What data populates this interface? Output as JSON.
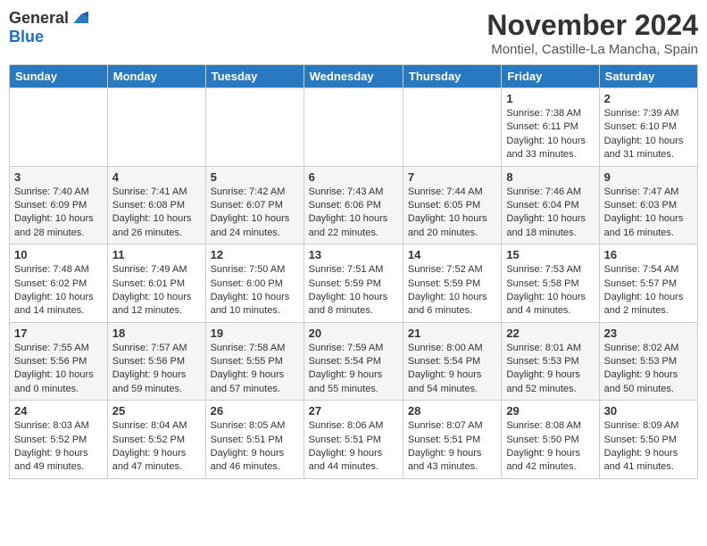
{
  "logo": {
    "general": "General",
    "blue": "Blue"
  },
  "title": "November 2024",
  "location": "Montiel, Castille-La Mancha, Spain",
  "days_of_week": [
    "Sunday",
    "Monday",
    "Tuesday",
    "Wednesday",
    "Thursday",
    "Friday",
    "Saturday"
  ],
  "weeks": [
    [
      {
        "day": "",
        "info": ""
      },
      {
        "day": "",
        "info": ""
      },
      {
        "day": "",
        "info": ""
      },
      {
        "day": "",
        "info": ""
      },
      {
        "day": "",
        "info": ""
      },
      {
        "day": "1",
        "info": "Sunrise: 7:38 AM\nSunset: 6:11 PM\nDaylight: 10 hours and 33 minutes."
      },
      {
        "day": "2",
        "info": "Sunrise: 7:39 AM\nSunset: 6:10 PM\nDaylight: 10 hours and 31 minutes."
      }
    ],
    [
      {
        "day": "3",
        "info": "Sunrise: 7:40 AM\nSunset: 6:09 PM\nDaylight: 10 hours and 28 minutes."
      },
      {
        "day": "4",
        "info": "Sunrise: 7:41 AM\nSunset: 6:08 PM\nDaylight: 10 hours and 26 minutes."
      },
      {
        "day": "5",
        "info": "Sunrise: 7:42 AM\nSunset: 6:07 PM\nDaylight: 10 hours and 24 minutes."
      },
      {
        "day": "6",
        "info": "Sunrise: 7:43 AM\nSunset: 6:06 PM\nDaylight: 10 hours and 22 minutes."
      },
      {
        "day": "7",
        "info": "Sunrise: 7:44 AM\nSunset: 6:05 PM\nDaylight: 10 hours and 20 minutes."
      },
      {
        "day": "8",
        "info": "Sunrise: 7:46 AM\nSunset: 6:04 PM\nDaylight: 10 hours and 18 minutes."
      },
      {
        "day": "9",
        "info": "Sunrise: 7:47 AM\nSunset: 6:03 PM\nDaylight: 10 hours and 16 minutes."
      }
    ],
    [
      {
        "day": "10",
        "info": "Sunrise: 7:48 AM\nSunset: 6:02 PM\nDaylight: 10 hours and 14 minutes."
      },
      {
        "day": "11",
        "info": "Sunrise: 7:49 AM\nSunset: 6:01 PM\nDaylight: 10 hours and 12 minutes."
      },
      {
        "day": "12",
        "info": "Sunrise: 7:50 AM\nSunset: 6:00 PM\nDaylight: 10 hours and 10 minutes."
      },
      {
        "day": "13",
        "info": "Sunrise: 7:51 AM\nSunset: 5:59 PM\nDaylight: 10 hours and 8 minutes."
      },
      {
        "day": "14",
        "info": "Sunrise: 7:52 AM\nSunset: 5:59 PM\nDaylight: 10 hours and 6 minutes."
      },
      {
        "day": "15",
        "info": "Sunrise: 7:53 AM\nSunset: 5:58 PM\nDaylight: 10 hours and 4 minutes."
      },
      {
        "day": "16",
        "info": "Sunrise: 7:54 AM\nSunset: 5:57 PM\nDaylight: 10 hours and 2 minutes."
      }
    ],
    [
      {
        "day": "17",
        "info": "Sunrise: 7:55 AM\nSunset: 5:56 PM\nDaylight: 10 hours and 0 minutes."
      },
      {
        "day": "18",
        "info": "Sunrise: 7:57 AM\nSunset: 5:56 PM\nDaylight: 9 hours and 59 minutes."
      },
      {
        "day": "19",
        "info": "Sunrise: 7:58 AM\nSunset: 5:55 PM\nDaylight: 9 hours and 57 minutes."
      },
      {
        "day": "20",
        "info": "Sunrise: 7:59 AM\nSunset: 5:54 PM\nDaylight: 9 hours and 55 minutes."
      },
      {
        "day": "21",
        "info": "Sunrise: 8:00 AM\nSunset: 5:54 PM\nDaylight: 9 hours and 54 minutes."
      },
      {
        "day": "22",
        "info": "Sunrise: 8:01 AM\nSunset: 5:53 PM\nDaylight: 9 hours and 52 minutes."
      },
      {
        "day": "23",
        "info": "Sunrise: 8:02 AM\nSunset: 5:53 PM\nDaylight: 9 hours and 50 minutes."
      }
    ],
    [
      {
        "day": "24",
        "info": "Sunrise: 8:03 AM\nSunset: 5:52 PM\nDaylight: 9 hours and 49 minutes."
      },
      {
        "day": "25",
        "info": "Sunrise: 8:04 AM\nSunset: 5:52 PM\nDaylight: 9 hours and 47 minutes."
      },
      {
        "day": "26",
        "info": "Sunrise: 8:05 AM\nSunset: 5:51 PM\nDaylight: 9 hours and 46 minutes."
      },
      {
        "day": "27",
        "info": "Sunrise: 8:06 AM\nSunset: 5:51 PM\nDaylight: 9 hours and 44 minutes."
      },
      {
        "day": "28",
        "info": "Sunrise: 8:07 AM\nSunset: 5:51 PM\nDaylight: 9 hours and 43 minutes."
      },
      {
        "day": "29",
        "info": "Sunrise: 8:08 AM\nSunset: 5:50 PM\nDaylight: 9 hours and 42 minutes."
      },
      {
        "day": "30",
        "info": "Sunrise: 8:09 AM\nSunset: 5:50 PM\nDaylight: 9 hours and 41 minutes."
      }
    ]
  ]
}
